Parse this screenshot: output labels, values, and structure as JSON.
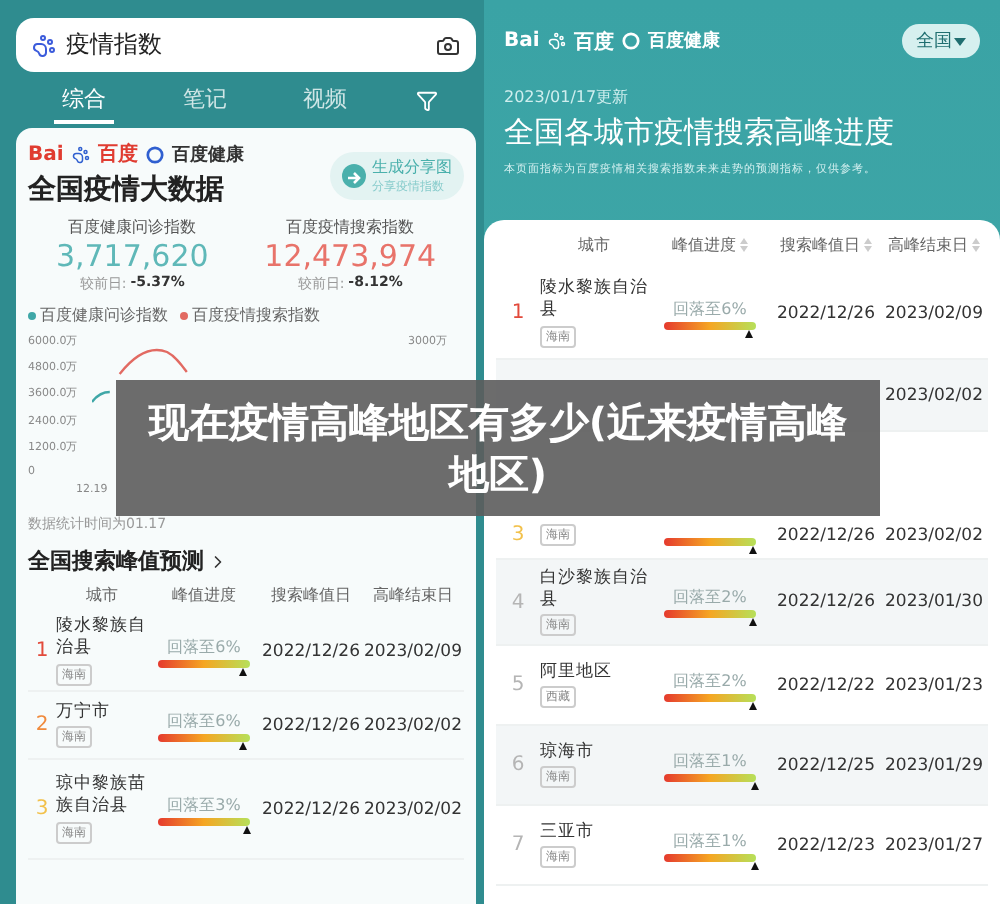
{
  "left": {
    "search": {
      "value": "疫情指数"
    },
    "tabs": [
      {
        "label": "综合",
        "selected": true
      },
      {
        "label": "笔记",
        "selected": false
      },
      {
        "label": "视频",
        "selected": false
      }
    ],
    "card": {
      "logo_left": "Bai",
      "logo_right": "百度",
      "brand": "百度健康",
      "title": "全国疫情大数据",
      "share": {
        "label": "生成分享图",
        "sub": "分享疫情指数"
      },
      "stats": [
        {
          "label": "百度健康问诊指数",
          "value": "3,717,620",
          "compare_label": "较前日:",
          "change": "-5.37%",
          "color": "#5fb8b8"
        },
        {
          "label": "百度疫情搜索指数",
          "value": "12,473,974",
          "compare_label": "较前日:",
          "change": "-8.12%",
          "color": "#e8736a"
        }
      ],
      "legend": [
        {
          "label": "百度健康问诊指数",
          "color": "#3fa7a7"
        },
        {
          "label": "百度疫情搜索指数",
          "color": "#e26a62"
        }
      ],
      "chart": {
        "left_ticks": [
          "6000.0万",
          "4800.0万",
          "3600.0万",
          "2400.0万",
          "1200.0万",
          "0"
        ],
        "right_ticks": [
          "3000万"
        ],
        "x_ticks": [
          "12.19"
        ]
      },
      "note": "数据统计时间为01.17",
      "section_title": "全国搜索峰值预测",
      "columns": [
        "城市",
        "峰值进度",
        "搜索峰值日",
        "高峰结束日"
      ],
      "rows": [
        {
          "rank": "1",
          "color": "#e24a3b",
          "city": "陵水黎族自治县",
          "region": "海南",
          "progress": "回落至6%",
          "level": 0.94,
          "peak": "2022/12/26",
          "end": "2023/02/09"
        },
        {
          "rank": "2",
          "color": "#f08a3c",
          "city": "万宁市",
          "region": "海南",
          "progress": "回落至6%",
          "level": 0.94,
          "peak": "2022/12/26",
          "end": "2023/02/02"
        },
        {
          "rank": "3",
          "color": "#f2c14b",
          "city": "琼中黎族苗族自治县",
          "region": "海南",
          "progress": "回落至3%",
          "level": 0.97,
          "peak": "2022/12/26",
          "end": "2023/02/02"
        }
      ]
    }
  },
  "right": {
    "logo_left": "Bai",
    "logo_right": "百度",
    "brand": "百度健康",
    "region_button": "全国",
    "updated": "2023/01/17更新",
    "title": "全国各城市疫情搜索高峰进度",
    "subtitle": "本页面指标为百度疫情相关搜索指数未来走势的预测指标，仅供参考。",
    "columns": [
      "城市",
      "峰值进度",
      "搜索峰值日",
      "高峰结束日"
    ],
    "rows": [
      {
        "rank": "1",
        "color": "#e24a3b",
        "city": "陵水黎族自治县",
        "region": "海南",
        "progress": "回落至6%",
        "level": 0.94,
        "peak": "2022/12/26",
        "end": "2023/02/09"
      },
      {
        "end": "2023/02/02"
      },
      {
        "rank": "3",
        "color": "#f2c14b",
        "region": "海南",
        "level": 0.97,
        "peak": "2022/12/26",
        "end": "2023/02/02"
      },
      {
        "rank": "4",
        "color": "#b5b5b5",
        "city": "白沙黎族自治县",
        "region": "海南",
        "progress": "回落至2%",
        "level": 0.98,
        "peak": "2022/12/26",
        "end": "2023/01/30"
      },
      {
        "rank": "5",
        "color": "#b5b5b5",
        "city": "阿里地区",
        "region": "西藏",
        "progress": "回落至2%",
        "level": 0.98,
        "peak": "2022/12/22",
        "end": "2023/01/23"
      },
      {
        "rank": "6",
        "color": "#b5b5b5",
        "city": "琼海市",
        "region": "海南",
        "progress": "回落至1%",
        "level": 0.99,
        "peak": "2022/12/25",
        "end": "2023/01/29"
      },
      {
        "rank": "7",
        "color": "#b5b5b5",
        "city": "三亚市",
        "region": "海南",
        "progress": "回落至1%",
        "level": 0.99,
        "peak": "2022/12/23",
        "end": "2023/01/27"
      }
    ]
  },
  "headline": "现在疫情高峰地区有多少(近来疫情高峰地区)"
}
